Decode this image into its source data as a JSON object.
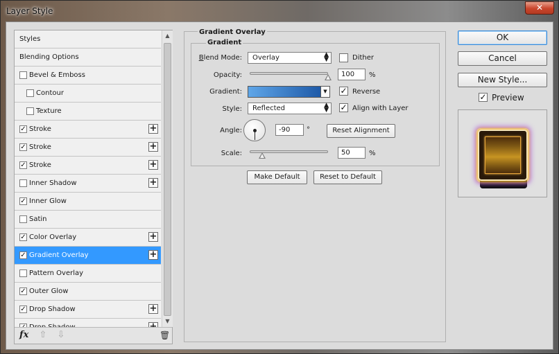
{
  "window": {
    "title": "Layer Style",
    "close_icon": "close-icon"
  },
  "styles_list": {
    "items": [
      {
        "label": "Styles",
        "has_checkbox": false,
        "checked": false,
        "has_plus": false,
        "indent": 0,
        "selected": false
      },
      {
        "label": "Blending Options",
        "has_checkbox": false,
        "checked": false,
        "has_plus": false,
        "indent": 0,
        "selected": false
      },
      {
        "label": "Bevel & Emboss",
        "has_checkbox": true,
        "checked": false,
        "has_plus": false,
        "indent": 0,
        "selected": false
      },
      {
        "label": "Contour",
        "has_checkbox": true,
        "checked": false,
        "has_plus": false,
        "indent": 1,
        "selected": false
      },
      {
        "label": "Texture",
        "has_checkbox": true,
        "checked": false,
        "has_plus": false,
        "indent": 1,
        "selected": false
      },
      {
        "label": "Stroke",
        "has_checkbox": true,
        "checked": true,
        "has_plus": true,
        "indent": 0,
        "selected": false
      },
      {
        "label": "Stroke",
        "has_checkbox": true,
        "checked": true,
        "has_plus": true,
        "indent": 0,
        "selected": false
      },
      {
        "label": "Stroke",
        "has_checkbox": true,
        "checked": true,
        "has_plus": true,
        "indent": 0,
        "selected": false
      },
      {
        "label": "Inner Shadow",
        "has_checkbox": true,
        "checked": false,
        "has_plus": true,
        "indent": 0,
        "selected": false
      },
      {
        "label": "Inner Glow",
        "has_checkbox": true,
        "checked": true,
        "has_plus": false,
        "indent": 0,
        "selected": false
      },
      {
        "label": "Satin",
        "has_checkbox": true,
        "checked": false,
        "has_plus": false,
        "indent": 0,
        "selected": false
      },
      {
        "label": "Color Overlay",
        "has_checkbox": true,
        "checked": true,
        "has_plus": true,
        "indent": 0,
        "selected": false
      },
      {
        "label": "Gradient Overlay",
        "has_checkbox": true,
        "checked": true,
        "has_plus": true,
        "indent": 0,
        "selected": true
      },
      {
        "label": "Pattern Overlay",
        "has_checkbox": true,
        "checked": false,
        "has_plus": false,
        "indent": 0,
        "selected": false
      },
      {
        "label": "Outer Glow",
        "has_checkbox": true,
        "checked": true,
        "has_plus": false,
        "indent": 0,
        "selected": false
      },
      {
        "label": "Drop Shadow",
        "has_checkbox": true,
        "checked": true,
        "has_plus": true,
        "indent": 0,
        "selected": false
      },
      {
        "label": "Drop Shadow",
        "has_checkbox": true,
        "checked": true,
        "has_plus": true,
        "indent": 0,
        "selected": false
      }
    ],
    "footer": {
      "fx_label": "fx",
      "move_up_icon": "arrow-up-icon",
      "move_down_icon": "arrow-down-icon",
      "delete_icon": "trash-icon"
    }
  },
  "gradient_overlay": {
    "section_title": "Gradient Overlay",
    "subsection_title": "Gradient",
    "blend_mode": {
      "label": "Blend Mode:",
      "value": "Overlay"
    },
    "dither": {
      "label": "Dither",
      "checked": false
    },
    "opacity": {
      "label": "Opacity:",
      "value": "100",
      "unit": "%",
      "level": 1.0
    },
    "gradient": {
      "label": "Gradient:",
      "color_start": "#5fa6e8",
      "color_end": "#1e5aa8"
    },
    "reverse": {
      "label": "Reverse",
      "checked": true
    },
    "style": {
      "label": "Style:",
      "value": "Reflected"
    },
    "align_with_layer": {
      "label": "Align with Layer",
      "checked": true
    },
    "angle": {
      "label": "Angle:",
      "value": "-90",
      "unit": "°"
    },
    "reset_alignment_label": "Reset Alignment",
    "scale": {
      "label": "Scale:",
      "value": "50",
      "unit": "%",
      "level": 0.16
    },
    "make_default_label": "Make Default",
    "reset_default_label": "Reset to Default"
  },
  "actions": {
    "ok_label": "OK",
    "cancel_label": "Cancel",
    "new_style_label": "New Style...",
    "preview": {
      "label": "Preview",
      "checked": true
    }
  },
  "colors": {
    "selection": "#3399ff",
    "dialog_bg": "#dcdcdc"
  }
}
